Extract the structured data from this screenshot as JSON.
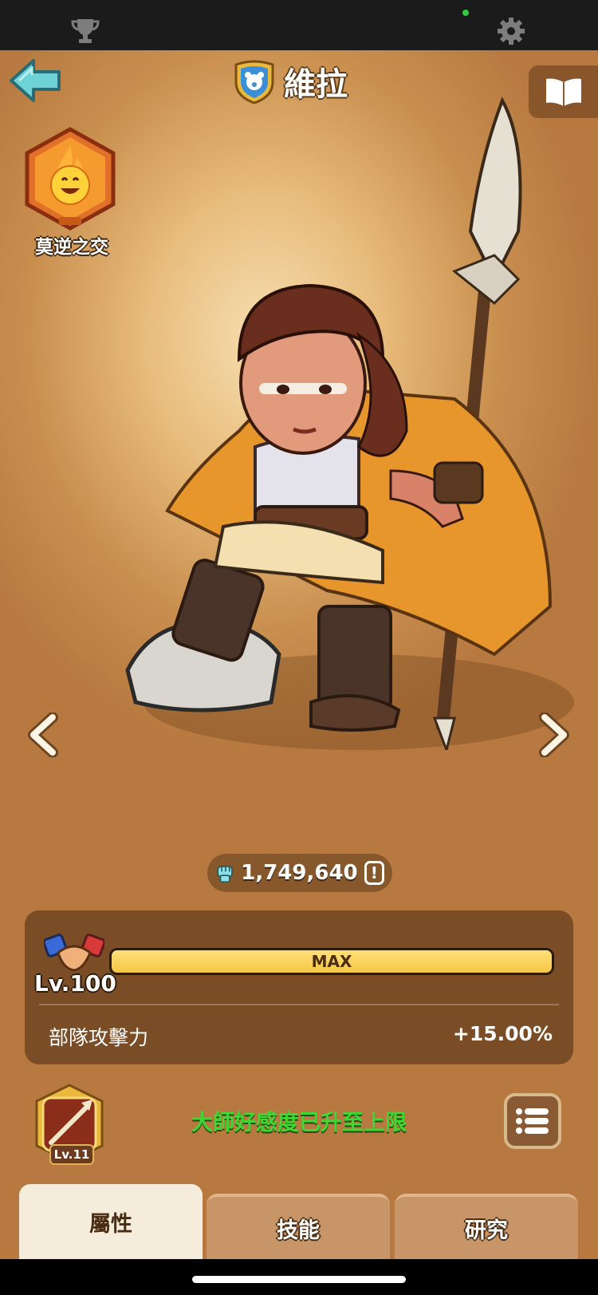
{
  "status_bar": {
    "icons": [
      "trophy-icon",
      "gear-icon"
    ],
    "camera_indicator_color": "#2ecc40"
  },
  "header": {
    "title": "維拉",
    "back_icon": "back-arrow-icon",
    "faction_icon": "bear-shield-icon",
    "codex_icon": "book-icon"
  },
  "bond_badge": {
    "label": "莫逆之交",
    "icon": "flame-smile-icon"
  },
  "hero": {
    "name": "維拉",
    "image": "hero-portrait"
  },
  "navigation": {
    "prev_icon": "chevron-left-icon",
    "next_icon": "chevron-right-icon"
  },
  "power": {
    "value": "1,749,640",
    "icon": "fist-icon",
    "info_icon": "exclamation-icon"
  },
  "level_panel": {
    "level": "Lv.100",
    "bar_label": "MAX",
    "progress": 1.0,
    "stat_label": "部隊攻擊力",
    "stat_value": "+15.00%"
  },
  "skill": {
    "level": "Lv.11",
    "icon": "spear-skill-icon"
  },
  "favor_message": "大師好感度已升至上限",
  "list_icon": "list-icon",
  "tabs": [
    {
      "label": "屬性",
      "active": true
    },
    {
      "label": "技能",
      "active": false
    },
    {
      "label": "研究",
      "active": false
    }
  ],
  "colors": {
    "favor_text": "#3fd832",
    "bar_fill": "#f6c744",
    "tab_active": "#f6ecdc",
    "tab_inactive": "#c79567"
  }
}
